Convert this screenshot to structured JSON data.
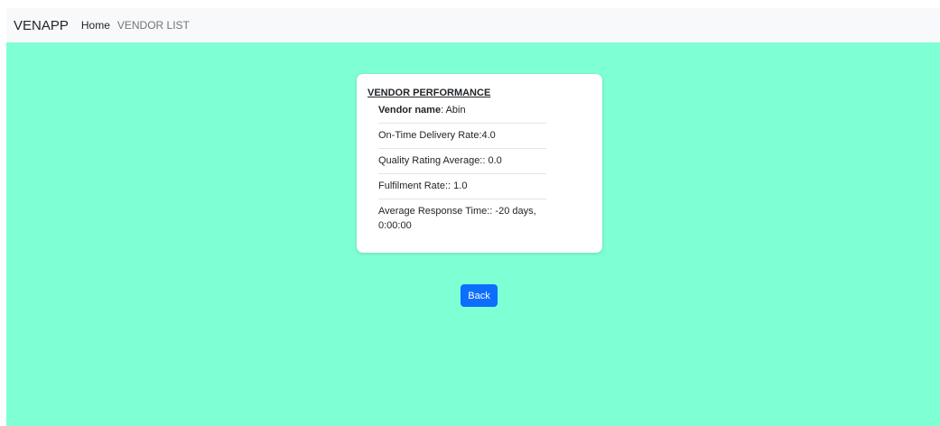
{
  "navbar": {
    "brand": "VENAPP",
    "links": [
      {
        "label": "Home"
      },
      {
        "label": "VENDOR LIST"
      }
    ]
  },
  "card": {
    "title": "VENDOR PERFORMANCE",
    "vendor_name_label": "Vendor name",
    "vendor_name_value": ": Abin",
    "on_time_delivery": "On-Time Delivery Rate:4.0",
    "quality_rating": "Quality Rating Average:: 0.0",
    "fulfilment_rate": "Fulfilment Rate:: 1.0",
    "avg_response_time": "Average Response Time:: -20 days, 0:00:00"
  },
  "back_button": {
    "label": "Back"
  },
  "colors": {
    "background": "#7fffd4",
    "navbar": "#f8f9fa",
    "primary": "#0d6efd"
  }
}
